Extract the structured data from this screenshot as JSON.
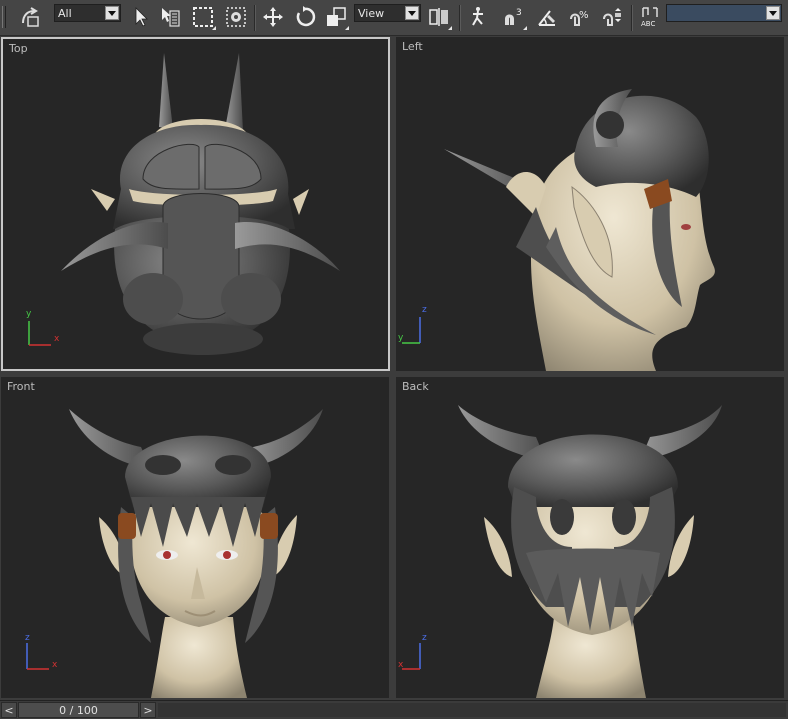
{
  "toolbar": {
    "selection_filter": "All",
    "coord_system": "View",
    "named_selection": "",
    "icons": [
      "undo-redo-icon",
      "select-icon",
      "select-by-name-icon",
      "region-select-icon",
      "window-crossing-icon",
      "move-icon",
      "rotate-icon",
      "scale-icon",
      "mirror-icon",
      "align-icon",
      "snap-3d-icon",
      "angle-snap-icon",
      "percent-snap-icon",
      "spinner-snap-icon",
      "edit-named-selection-icon"
    ]
  },
  "viewports": {
    "top": {
      "label": "Top"
    },
    "left": {
      "label": "Left"
    },
    "front": {
      "label": "Front"
    },
    "back": {
      "label": "Back"
    }
  },
  "axis": {
    "x": "x",
    "y": "y",
    "z": "z"
  },
  "colors": {
    "skin": "#d8ccb0",
    "helmet": "#5e5e5e",
    "strap": "#8a4a20",
    "viewport_bg": "#262626",
    "active_border": "#c8c8c8",
    "axis_x": "#d23232",
    "axis_y": "#46c846",
    "axis_z": "#4b6ee6"
  },
  "timeline": {
    "frame": "0 / 100",
    "prev": "<",
    "next": ">"
  }
}
